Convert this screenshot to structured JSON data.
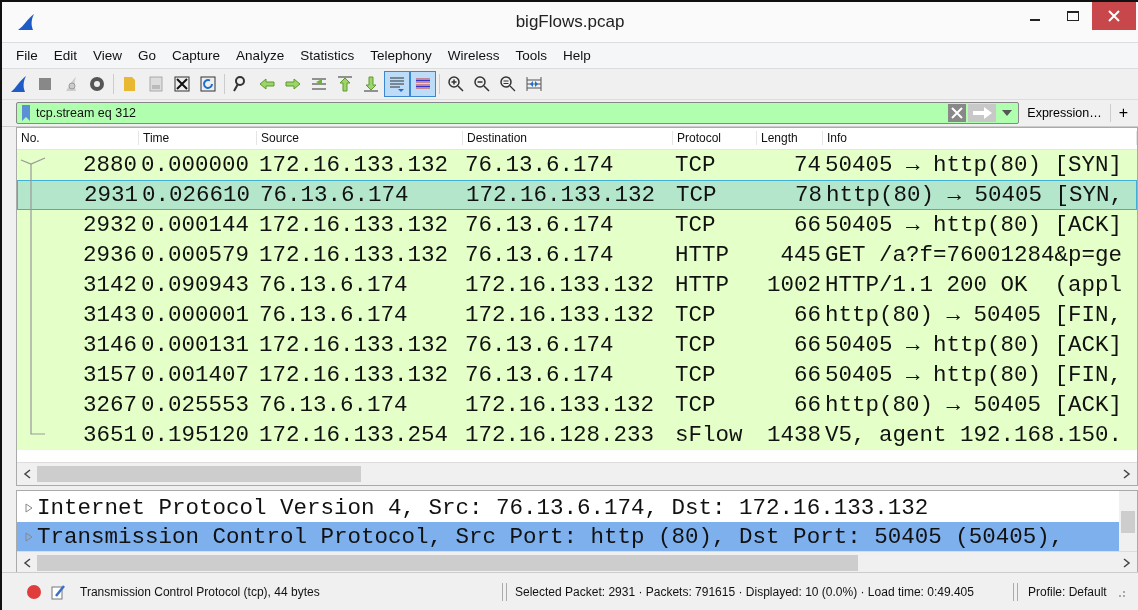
{
  "window": {
    "title": "bigFlows.pcap"
  },
  "menu": [
    "File",
    "Edit",
    "View",
    "Go",
    "Capture",
    "Analyze",
    "Statistics",
    "Telephony",
    "Wireless",
    "Tools",
    "Help"
  ],
  "toolbar": [
    [
      {
        "kind": "shark",
        "on": false
      },
      {
        "kind": "stop",
        "on": false
      },
      {
        "kind": "restart",
        "on": false
      },
      {
        "kind": "options",
        "on": false
      }
    ],
    [
      {
        "kind": "open",
        "on": false
      },
      {
        "kind": "save",
        "on": false
      },
      {
        "kind": "close",
        "on": false
      },
      {
        "kind": "reload",
        "on": false
      }
    ],
    [
      {
        "kind": "find",
        "on": false
      },
      {
        "kind": "back",
        "on": false
      },
      {
        "kind": "forward",
        "on": false
      },
      {
        "kind": "goto",
        "on": false
      },
      {
        "kind": "first",
        "on": false
      },
      {
        "kind": "last",
        "on": false
      },
      {
        "kind": "autoscroll",
        "on": true
      },
      {
        "kind": "colorize",
        "on": true
      }
    ],
    [
      {
        "kind": "zoomin",
        "on": false
      },
      {
        "kind": "zoomout",
        "on": false
      },
      {
        "kind": "zoomreset",
        "on": false
      },
      {
        "kind": "resize",
        "on": false
      }
    ]
  ],
  "filter": {
    "value": "tcp.stream eq 312",
    "expression": "Expression…",
    "add": "+"
  },
  "table": {
    "columns": [
      "No.",
      "Time",
      "Source",
      "Destination",
      "Protocol",
      "Length",
      "Info"
    ],
    "rows": [
      {
        "no": "2880",
        "time": "0.000000",
        "source": "172.16.133.132",
        "destination": "76.13.6.174",
        "protocol": "TCP",
        "length": "74",
        "info": "50405 → http(80) [SYN]",
        "selected": false
      },
      {
        "no": "2931",
        "time": "0.026610",
        "source": "76.13.6.174",
        "destination": "172.16.133.132",
        "protocol": "TCP",
        "length": "78",
        "info": "http(80) → 50405 [SYN,",
        "selected": true
      },
      {
        "no": "2932",
        "time": "0.000144",
        "source": "172.16.133.132",
        "destination": "76.13.6.174",
        "protocol": "TCP",
        "length": "66",
        "info": "50405 → http(80) [ACK]",
        "selected": false
      },
      {
        "no": "2936",
        "time": "0.000579",
        "source": "172.16.133.132",
        "destination": "76.13.6.174",
        "protocol": "HTTP",
        "length": "445",
        "info": "GET /a?f=76001284&p=ge",
        "selected": false
      },
      {
        "no": "3142",
        "time": "0.090943",
        "source": "76.13.6.174",
        "destination": "172.16.133.132",
        "protocol": "HTTP",
        "length": "1002",
        "info": "HTTP/1.1 200 OK  (appl",
        "selected": false
      },
      {
        "no": "3143",
        "time": "0.000001",
        "source": "76.13.6.174",
        "destination": "172.16.133.132",
        "protocol": "TCP",
        "length": "66",
        "info": "http(80) → 50405 [FIN,",
        "selected": false
      },
      {
        "no": "3146",
        "time": "0.000131",
        "source": "172.16.133.132",
        "destination": "76.13.6.174",
        "protocol": "TCP",
        "length": "66",
        "info": "50405 → http(80) [ACK]",
        "selected": false
      },
      {
        "no": "3157",
        "time": "0.001407",
        "source": "172.16.133.132",
        "destination": "76.13.6.174",
        "protocol": "TCP",
        "length": "66",
        "info": "50405 → http(80) [FIN,",
        "selected": false
      },
      {
        "no": "3267",
        "time": "0.025553",
        "source": "76.13.6.174",
        "destination": "172.16.133.132",
        "protocol": "TCP",
        "length": "66",
        "info": "http(80) → 50405 [ACK]",
        "selected": false
      },
      {
        "no": "3651",
        "time": "0.195120",
        "source": "172.16.133.254",
        "destination": "172.16.128.233",
        "protocol": "sFlow",
        "length": "1438",
        "info": "V5, agent 192.168.150.",
        "selected": false
      }
    ]
  },
  "details": [
    {
      "text": "Internet Protocol Version 4, Src: 76.13.6.174, Dst: 172.16.133.132",
      "expanded": false,
      "selected": false
    },
    {
      "text": "Transmission Control Protocol, Src Port: http (80), Dst Port: 50405 (50405),",
      "expanded": false,
      "selected": true
    }
  ],
  "status_bar": {
    "field": "Transmission Control Protocol (tcp), 44 bytes",
    "stats": "Selected Packet: 2931 · Packets: 791615 · Displayed: 10 (0.0%) · Load time: 0:49.405",
    "profile": "Profile: Default"
  }
}
